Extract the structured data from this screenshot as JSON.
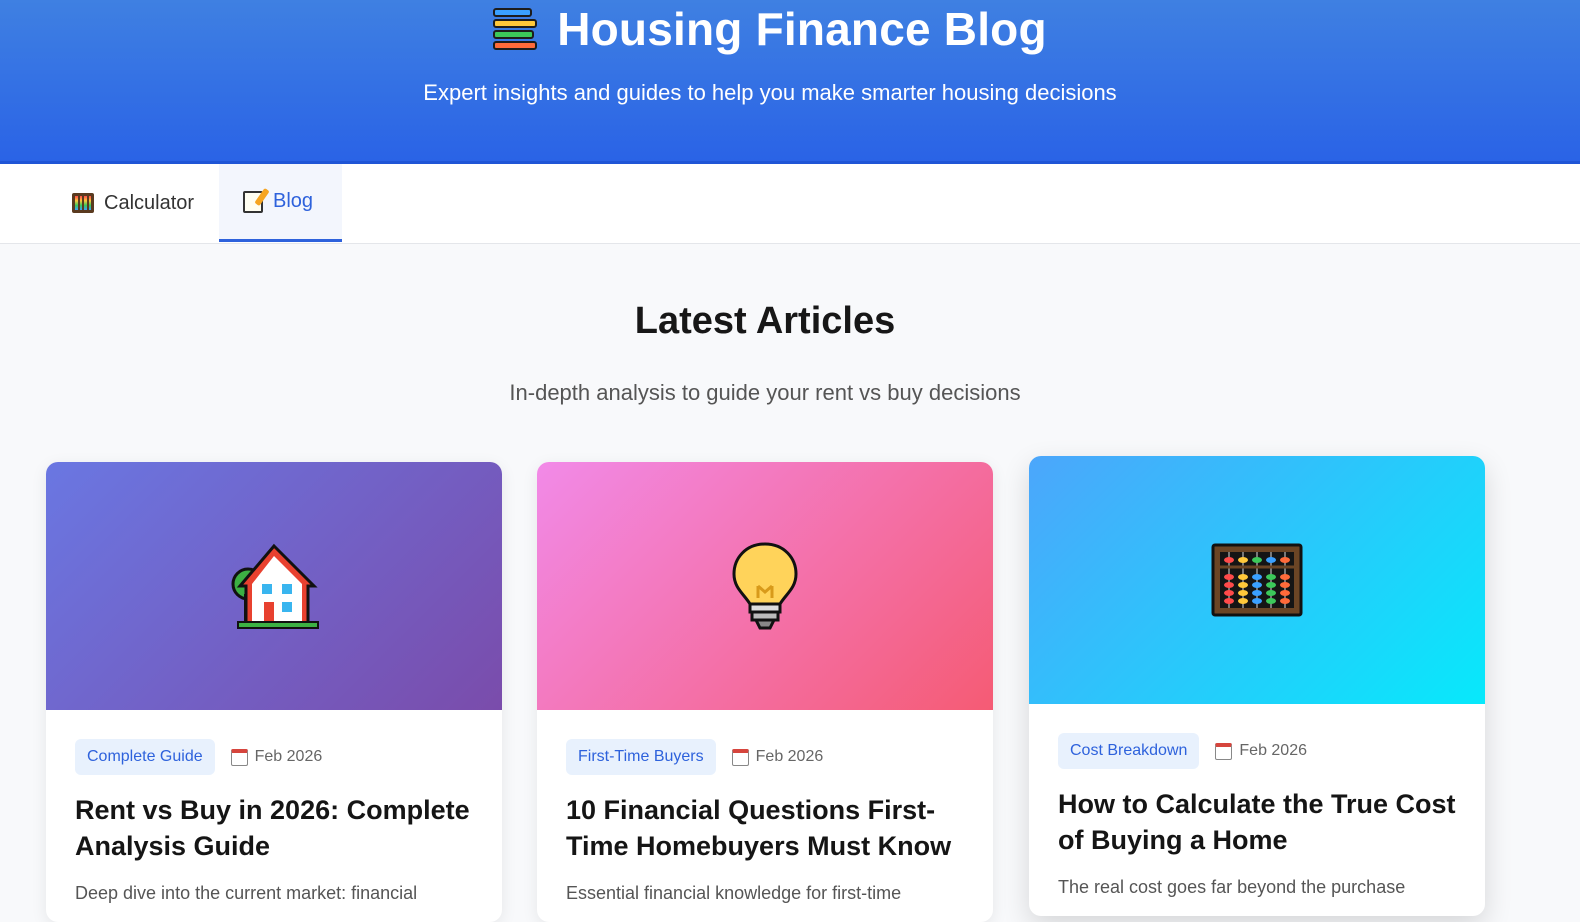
{
  "header": {
    "title": "Housing Finance Blog",
    "subtitle": "Expert insights and guides to help you make smarter housing decisions",
    "logo_icon": "books-icon"
  },
  "tabs": [
    {
      "label": "Calculator",
      "icon": "abacus-icon",
      "active": false
    },
    {
      "label": "Blog",
      "icon": "memo-icon",
      "active": true
    }
  ],
  "section": {
    "title": "Latest Articles",
    "subtitle": "In-depth analysis to guide your rent vs buy decisions"
  },
  "articles": [
    {
      "icon": "house-icon",
      "category": "Complete Guide",
      "date": "Feb 2026",
      "title": "Rent vs Buy in 2026: Complete Analysis Guide",
      "excerpt": "Deep dive into the current market: financial"
    },
    {
      "icon": "lightbulb-icon",
      "category": "First-Time Buyers",
      "date": "Feb 2026",
      "title": "10 Financial Questions First-Time Homebuyers Must Know",
      "excerpt": "Essential financial knowledge for first-time"
    },
    {
      "icon": "abacus-icon",
      "category": "Cost Breakdown",
      "date": "Feb 2026",
      "title": "How to Calculate the True Cost of Buying a Home",
      "excerpt": "The real cost goes far beyond the purchase"
    }
  ],
  "colors": {
    "accent": "#2e62dc",
    "hero_top": "#3f80e2",
    "hero_bottom": "#2a63e6"
  }
}
